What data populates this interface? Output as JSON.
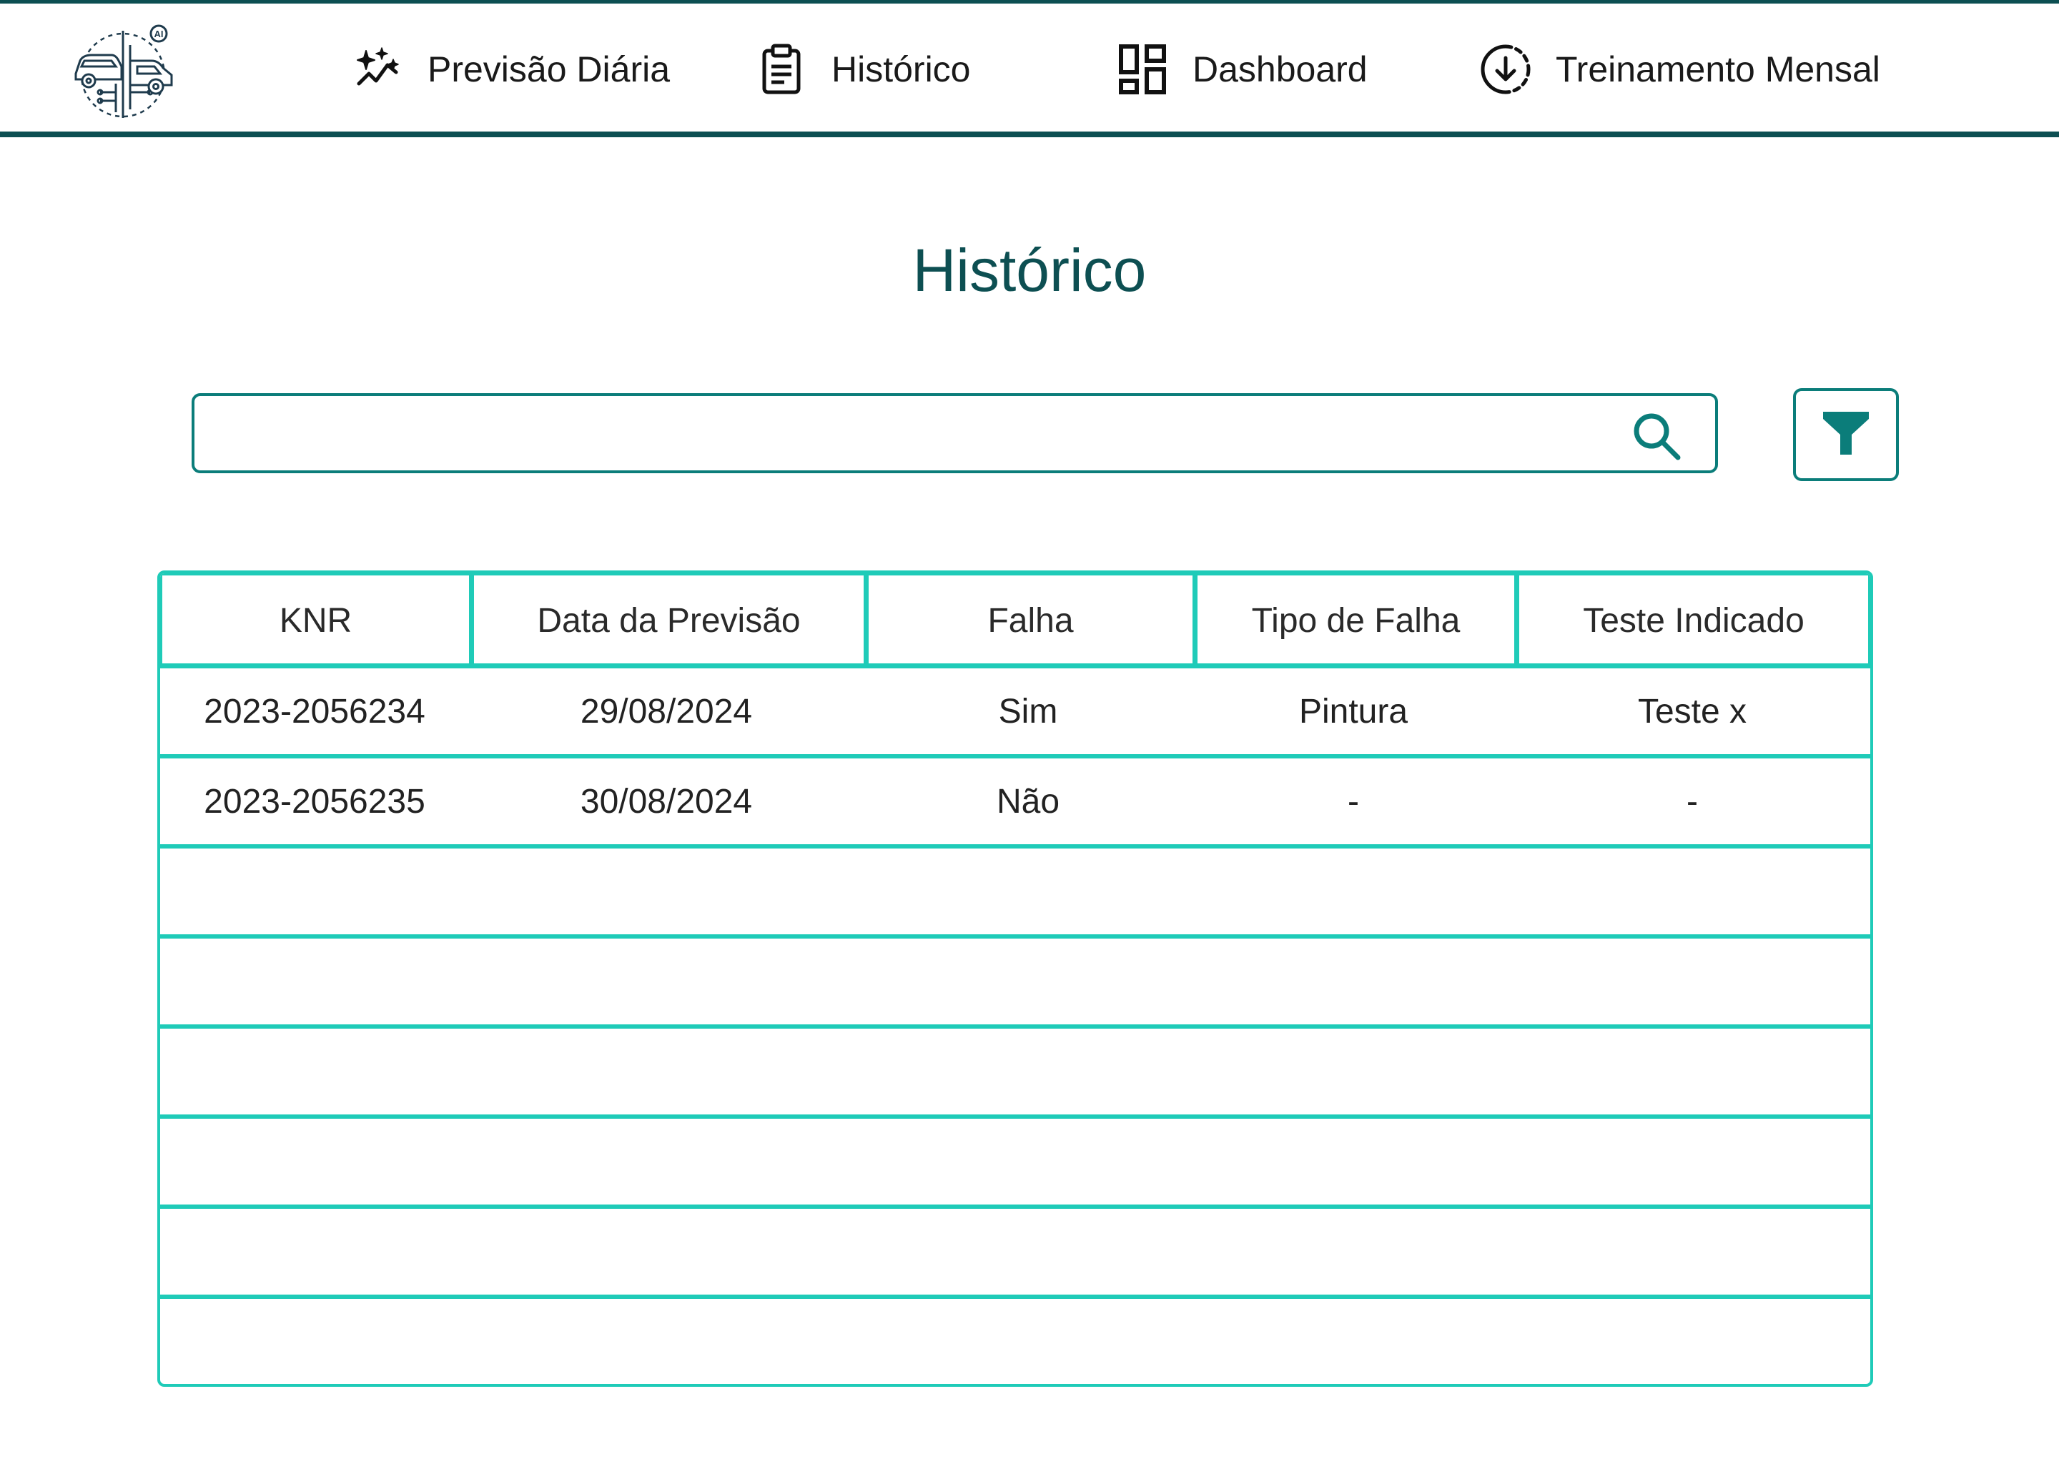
{
  "nav": {
    "items": [
      {
        "label": "Previsão Diária",
        "icon": "sparkle-chart-icon"
      },
      {
        "label": "Histórico",
        "icon": "clipboard-icon"
      },
      {
        "label": "Dashboard",
        "icon": "dashboard-icon"
      },
      {
        "label": "Treinamento Mensal",
        "icon": "download-circle-icon"
      }
    ],
    "logo_badge": "AI"
  },
  "page": {
    "title": "Histórico"
  },
  "search": {
    "value": "",
    "placeholder": ""
  },
  "table": {
    "headers": [
      "KNR",
      "Data da Previsão",
      "Falha",
      "Tipo de Falha",
      "Teste Indicado"
    ],
    "rows": [
      [
        "2023-2056234",
        "29/08/2024",
        "Sim",
        "Pintura",
        "Teste x"
      ],
      [
        "2023-2056235",
        "30/08/2024",
        "Não",
        "-",
        "-"
      ],
      [
        "",
        "",
        "",
        "",
        ""
      ],
      [
        "",
        "",
        "",
        "",
        ""
      ],
      [
        "",
        "",
        "",
        "",
        ""
      ],
      [
        "",
        "",
        "",
        "",
        ""
      ],
      [
        "",
        "",
        "",
        "",
        ""
      ],
      [
        "",
        "",
        "",
        "",
        ""
      ]
    ]
  },
  "colors": {
    "brand_dark": "#0d4f52",
    "accent_teal": "#0b7d7a",
    "table_border": "#1fcbb8"
  }
}
